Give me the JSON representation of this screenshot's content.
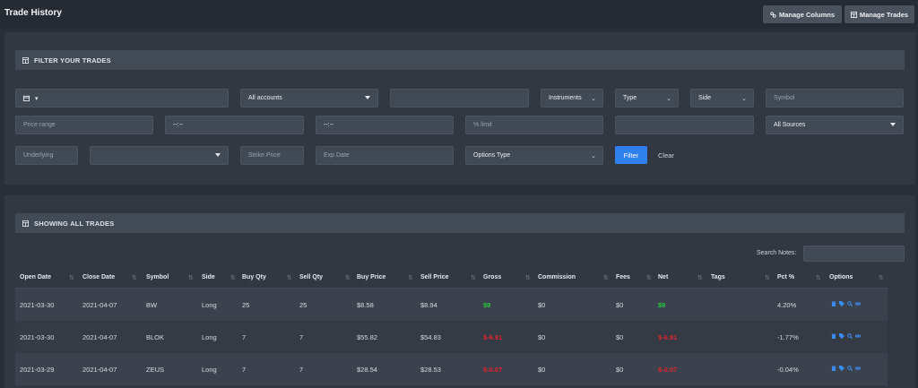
{
  "header": {
    "title": "Trade History",
    "manage_columns": "Manage Columns",
    "manage_trades": "Manage Trades"
  },
  "filter": {
    "section_title": "FILTER YOUR TRADES",
    "date_value": "",
    "accounts": "All accounts",
    "instruments": "Instruments",
    "type": "Type",
    "side": "Side",
    "symbol_placeholder": "Symbol",
    "price_range_placeholder": "Price range",
    "time_from": "--:--",
    "time_to": "--:--",
    "pct_limit_placeholder": "% limit",
    "sources": "All Sources",
    "underlying_placeholder": "Underlying",
    "strike_placeholder": "Strike Price",
    "exp_placeholder": "Exp Date",
    "options_type": "Options Type",
    "filter_button": "Filter",
    "clear_button": "Clear"
  },
  "trades": {
    "section_title": "SHOWING ALL TRADES",
    "search_label": "Search Notes:",
    "columns": [
      "Open Date",
      "Close Date",
      "Symbol",
      "Side",
      "Buy Qty",
      "Sell Qty",
      "Buy Price",
      "Sell Price",
      "Gross",
      "Commission",
      "Fees",
      "Net",
      "Tags",
      "Pct %",
      "Options"
    ],
    "rows": [
      {
        "open": "2021-03-30",
        "close": "2021-04-07",
        "symbol": "BW",
        "side": "Long",
        "buy_qty": "25",
        "sell_qty": "25",
        "buy_price": "$8.58",
        "sell_price": "$8.94",
        "gross": "$9",
        "commission": "$0",
        "fees": "$0",
        "net": "$9",
        "tags": "",
        "pct": "4.20%"
      },
      {
        "open": "2021-03-30",
        "close": "2021-04-07",
        "symbol": "BLOK",
        "side": "Long",
        "buy_qty": "7",
        "sell_qty": "7",
        "buy_price": "$55.82",
        "sell_price": "$54.83",
        "gross": "$-6.91",
        "commission": "$0",
        "fees": "$0",
        "net": "$-6.91",
        "tags": "",
        "pct": "-1.77%"
      },
      {
        "open": "2021-03-29",
        "close": "2021-04-07",
        "symbol": "ZEUS",
        "side": "Long",
        "buy_qty": "7",
        "sell_qty": "7",
        "buy_price": "$28.54",
        "sell_price": "$28.53",
        "gross": "$-0.07",
        "commission": "$0",
        "fees": "$0",
        "net": "$-0.07",
        "tags": "",
        "pct": "-0.04%"
      }
    ]
  },
  "colors": {
    "positive": "#27c93f",
    "negative": "#e0242e",
    "accent": "#2f80ed",
    "icon": "#3b8cf0"
  }
}
